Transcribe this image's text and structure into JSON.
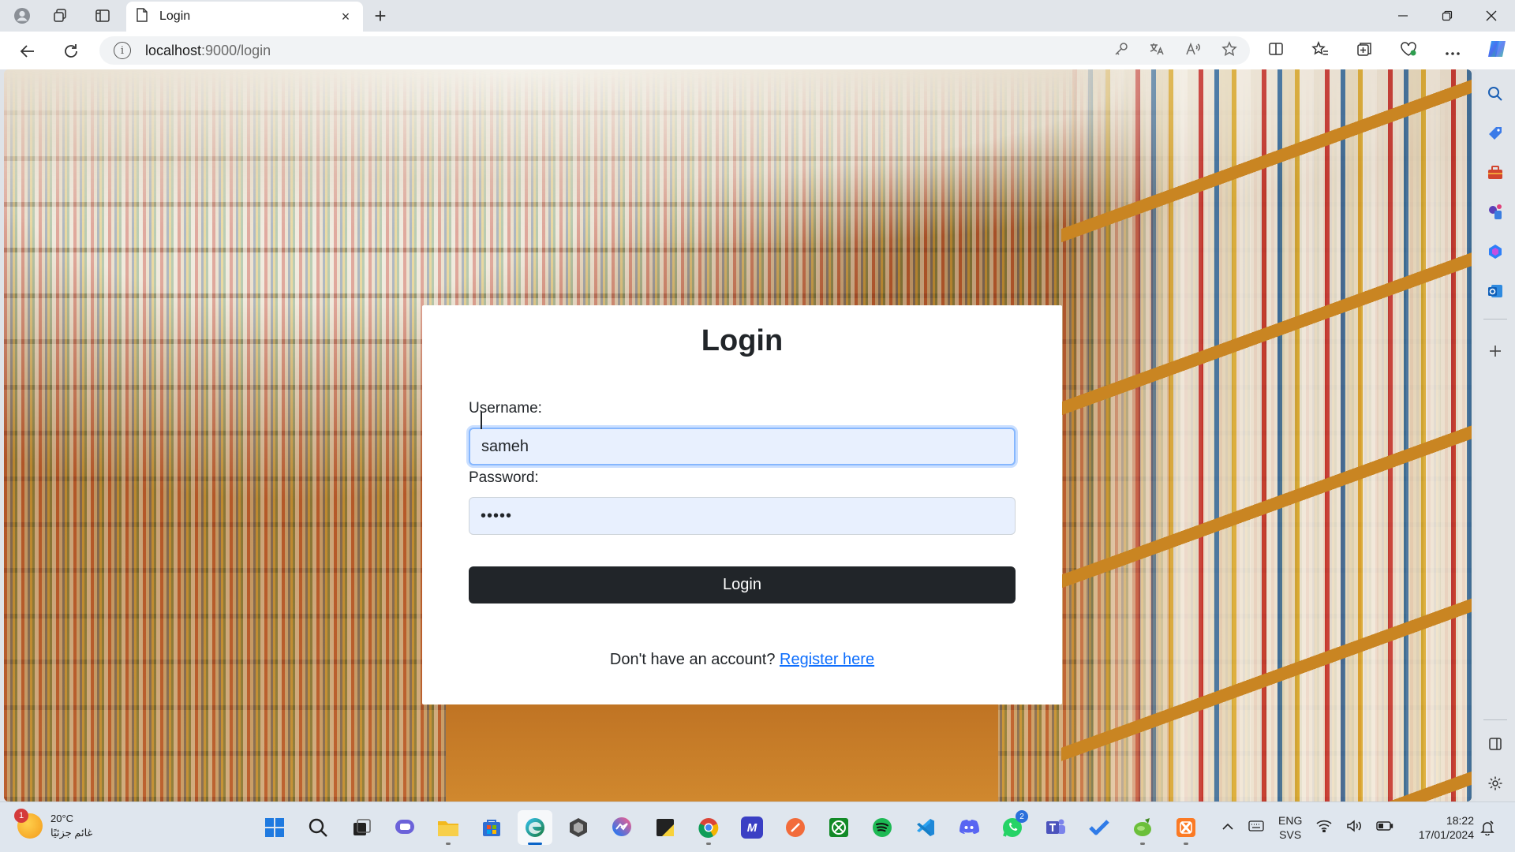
{
  "browser": {
    "tab_title": "Login",
    "tab_close": "×",
    "new_tab": "+",
    "url_host": "localhost",
    "url_path": ":9000/login",
    "info_glyph": "i"
  },
  "page": {
    "heading": "Login",
    "username_label": "Username:",
    "username_value": "sameh",
    "password_label": "Password:",
    "password_value": "•••••",
    "login_button": "Login",
    "footer_text": "Don't have an account?",
    "register_link": "Register here"
  },
  "taskbar": {
    "weather_temp": "20°C",
    "weather_desc": "غائم جزئيًا",
    "weather_badge": "1",
    "whatsapp_badge": "2",
    "discord_badge": "",
    "lang_top": "ENG",
    "lang_bottom": "SVS",
    "time": "18:22",
    "date": "17/01/2024"
  },
  "icons": {
    "profile": "profile-icon",
    "workspaces": "workspaces-icon",
    "tab_actions": "tab-actions-icon",
    "page": "page-icon",
    "back": "back-arrow-icon",
    "refresh": "refresh-icon",
    "search": "search-icon",
    "copilot": "copilot-icon",
    "settings": "gear-icon"
  },
  "colors": {
    "login_button_bg": "#212529",
    "link": "#0d6efd",
    "input_bg": "#e8f0fe",
    "focus_ring": "#86b7fe"
  }
}
